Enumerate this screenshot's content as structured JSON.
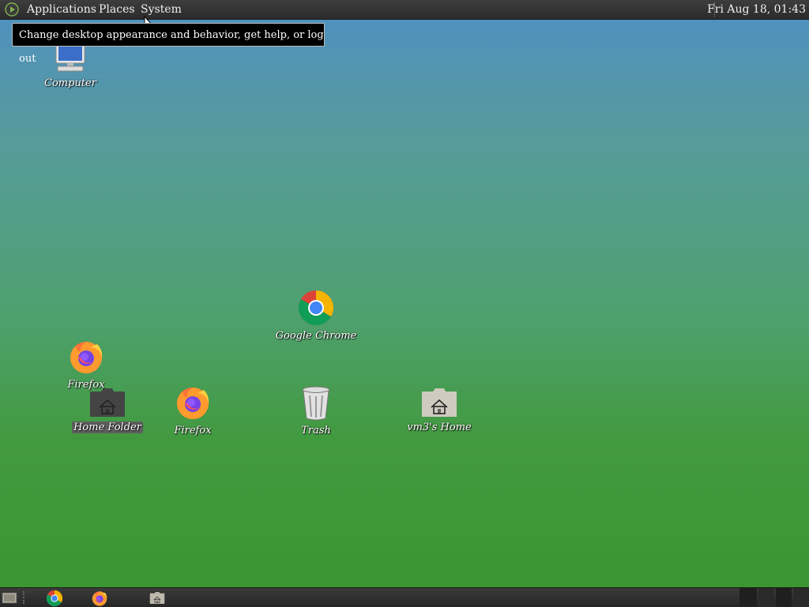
{
  "top_panel": {
    "menus": {
      "applications": "Applications",
      "places": "Places",
      "system": "System"
    },
    "clock": "Fri Aug 18, 01:43"
  },
  "tooltip": {
    "text": "Change desktop appearance and behavior, get help, or log out"
  },
  "desktop": {
    "icons": {
      "computer": "Computer",
      "firefox_1": "Firefox",
      "home_folder": "Home Folder",
      "firefox_2": "Firefox",
      "google_chrome": "Google Chrome",
      "trash": "Trash",
      "vm3_home": "vm3's Home"
    }
  },
  "bottom_panel": {
    "launchers": [
      "show-desktop-icon",
      "chrome-icon",
      "firefox-icon",
      "home-folder-icon"
    ]
  },
  "colors": {
    "panel": "#2e2e2e",
    "desktop_top": "#4f8fc4",
    "desktop_bottom": "#3a9630",
    "tooltip_bg": "#000000"
  }
}
